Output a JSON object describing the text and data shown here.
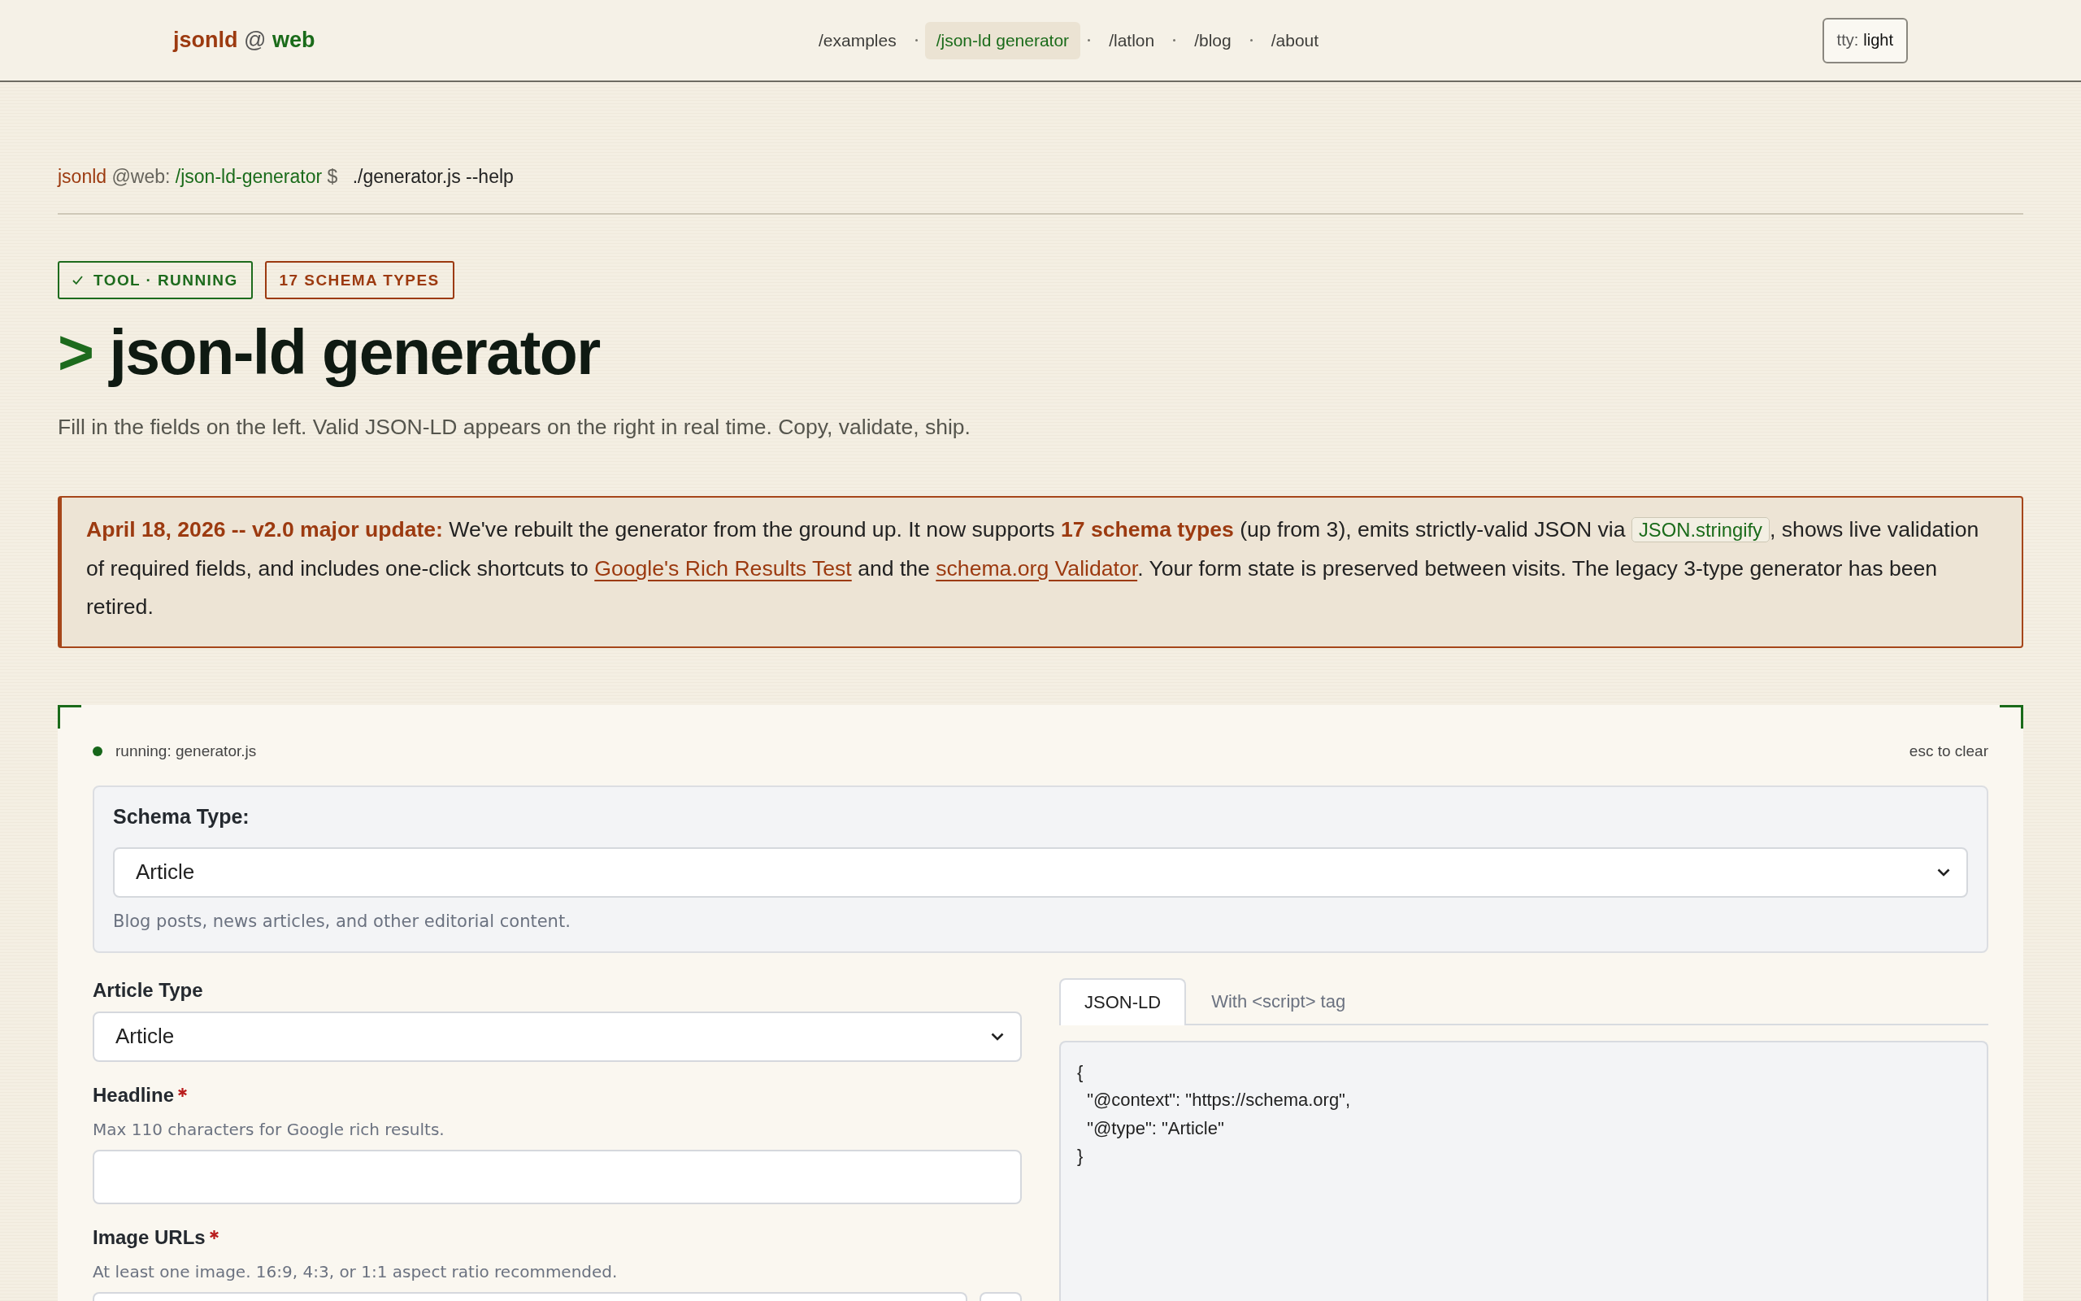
{
  "header": {
    "logo": {
      "user": "jsonld",
      "at": "@",
      "host": "web"
    },
    "nav": [
      {
        "label": "/examples",
        "selected": false
      },
      {
        "label": "/json-ld generator",
        "selected": true
      },
      {
        "label": "/latlon",
        "selected": false
      },
      {
        "label": "/blog",
        "selected": false
      },
      {
        "label": "/about",
        "selected": false
      }
    ],
    "theme_button": {
      "prefix": "tty:",
      "value": "light"
    }
  },
  "prompt": {
    "user": "jsonld",
    "host": "@web:",
    "path": "/json-ld-generator",
    "symbol": "$",
    "command": "./generator.js --help"
  },
  "badges": [
    {
      "kind": "status",
      "label": "TOOL · RUNNING",
      "color": "#1d6b1d"
    },
    {
      "kind": "count",
      "label": "17 SCHEMA TYPES",
      "color": "#9c3a10"
    }
  ],
  "title": {
    "prompt": ">",
    "text": "json-ld generator"
  },
  "subtitle": "Fill in the fields on the left. Valid JSON-LD appears on the right in real time. Copy, validate, ship.",
  "notice": {
    "segments": [
      {
        "kind": "text",
        "text": "**April 18, 2026 -- v2.0 major update:** We've rebuilt the generator from the ground up. It now supports **17 schema types** (up from 3), emits strictly-valid JSON via "
      },
      {
        "kind": "code",
        "text": "JSON.stringify"
      },
      {
        "kind": "text",
        "text": ", shows live validation of required fields, and includes one-click shortcuts to "
      },
      {
        "kind": "link",
        "text": "Google's Rich Results Test"
      },
      {
        "kind": "text",
        "text": " and the "
      },
      {
        "kind": "link",
        "text": "schema.org Validator"
      },
      {
        "kind": "text",
        "text": ". Your form state is preserved between visits. The legacy 3-type generator has been retired."
      }
    ]
  },
  "panel": {
    "status": {
      "active": true,
      "label": "running: generator.js"
    },
    "shortcut_hint": "esc to clear",
    "schema_type": {
      "label": "Schema Type:",
      "value": "Article",
      "hint": "Blog posts, news articles, and other editorial content."
    },
    "fields": [
      {
        "kind": "select",
        "label": "Article Type",
        "required": false,
        "value": "Article"
      },
      {
        "kind": "text",
        "label": "Headline",
        "required": true,
        "hint": "Max 110 characters for Google rich results."
      },
      {
        "kind": "url-list",
        "label": "Image URLs",
        "required": true,
        "hint": "At least one image. 16:9, 4:3, or 1:1 aspect ratio recommended."
      }
    ],
    "output": {
      "tabs": [
        {
          "label": "JSON-LD",
          "selected": true
        },
        {
          "label": "With <script> tag",
          "selected": false
        }
      ],
      "code": [
        "{",
        "  \"@context\": \"https://schema.org\",",
        "  \"@type\": \"Article\"",
        "}"
      ]
    }
  }
}
